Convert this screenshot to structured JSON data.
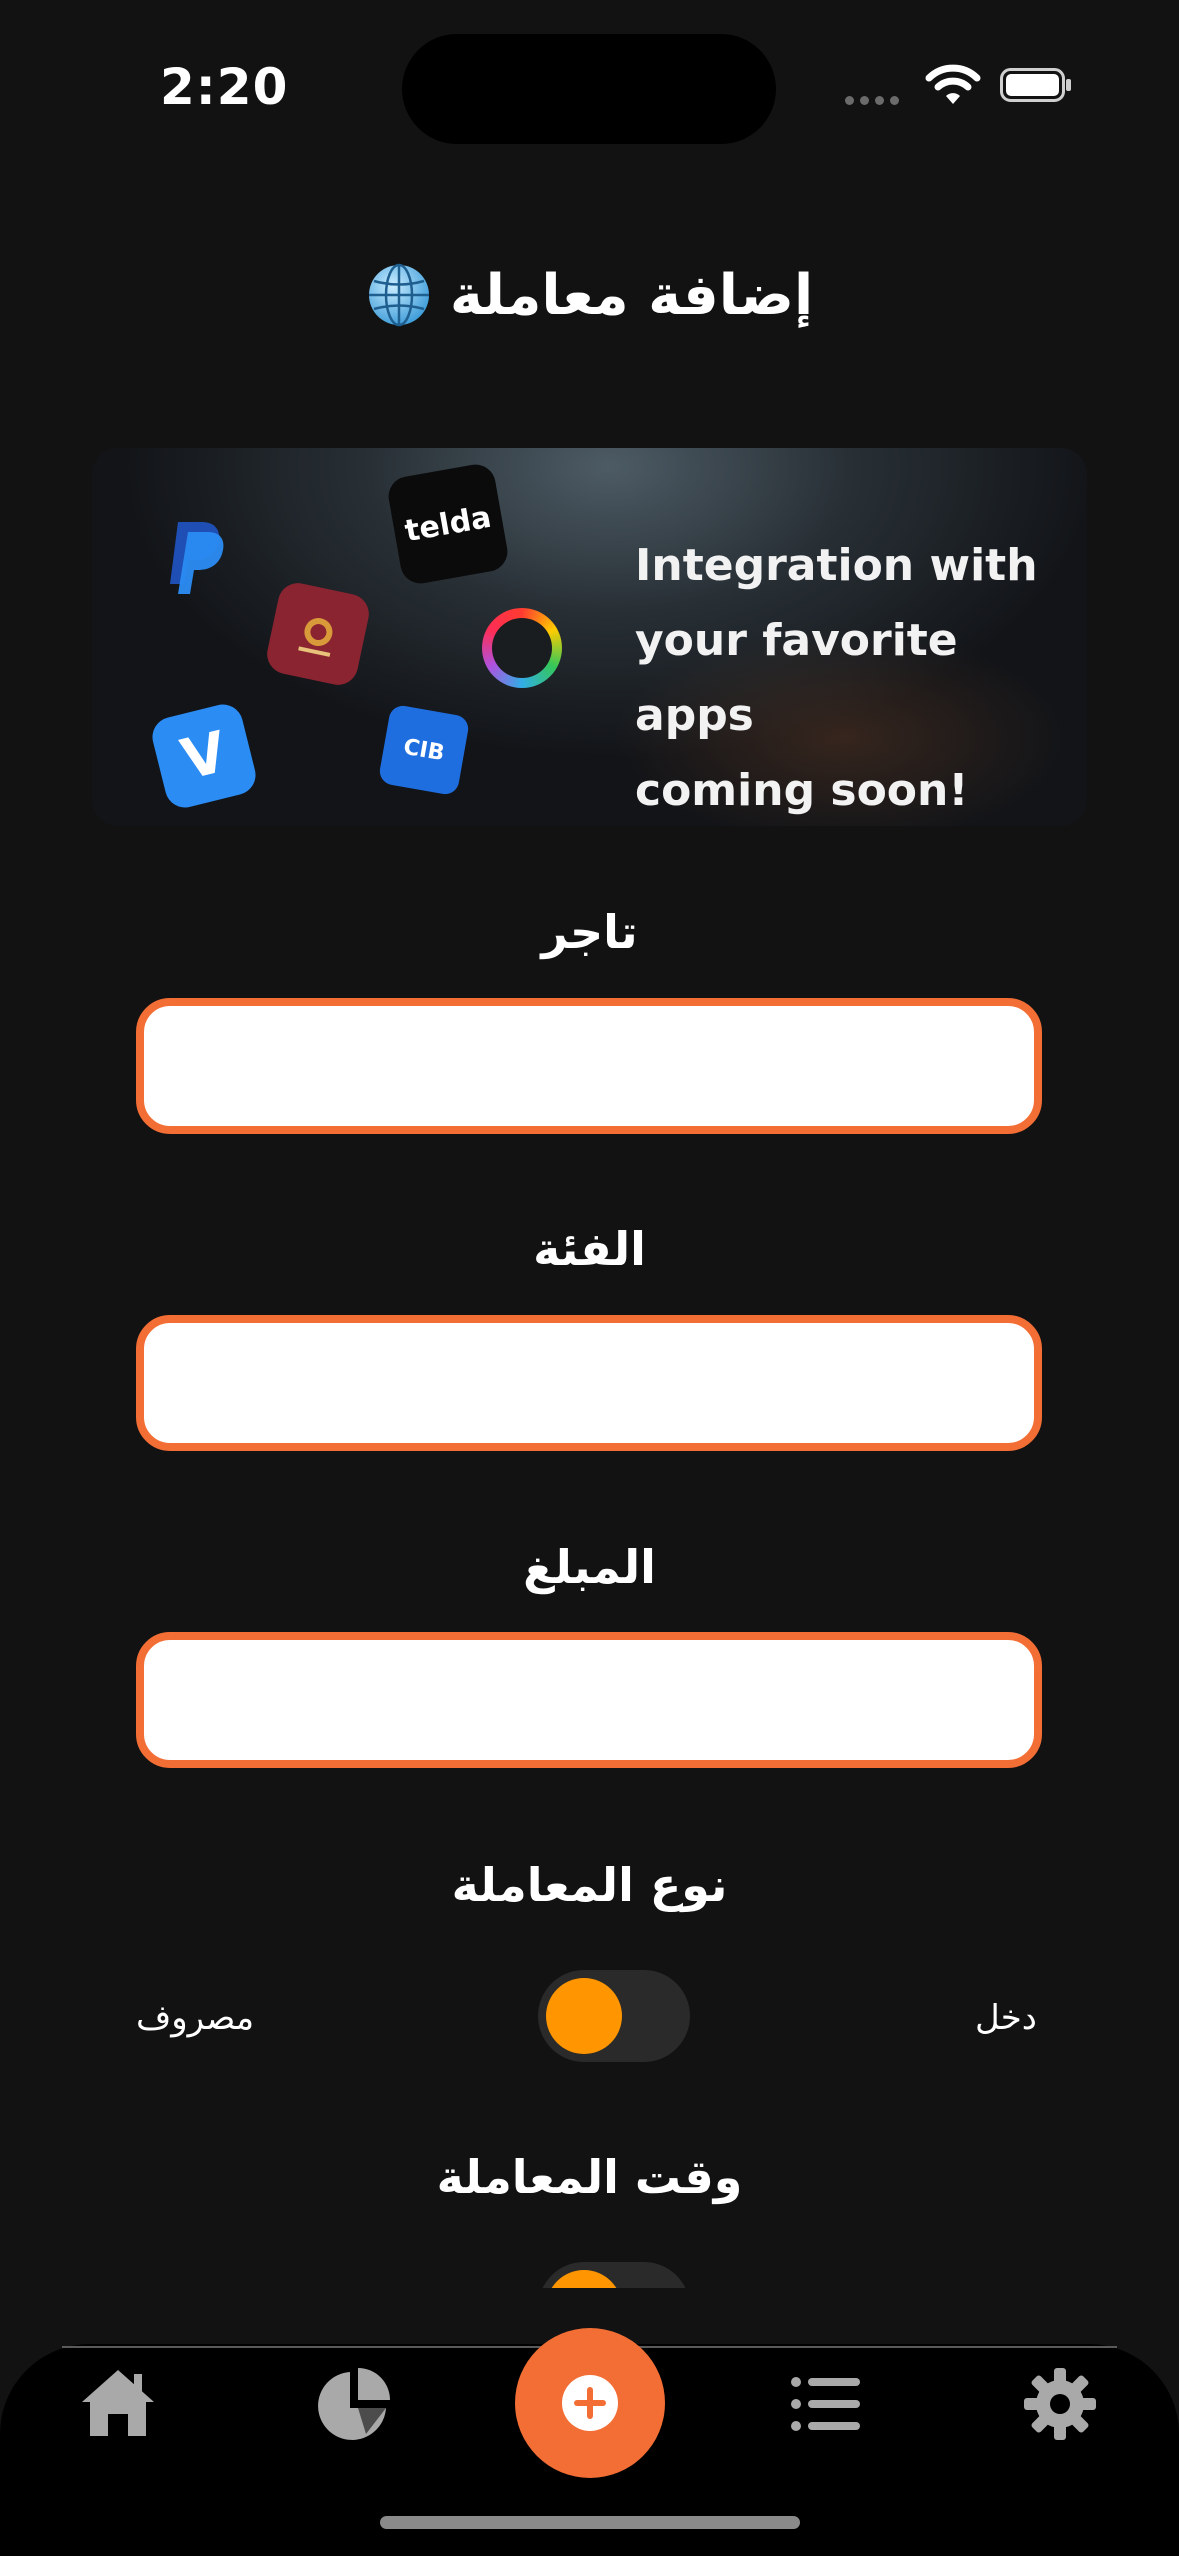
{
  "status_bar": {
    "time": "2:20",
    "icons": [
      "signal-dots-icon",
      "wifi-icon",
      "battery-icon"
    ]
  },
  "header": {
    "title": "إضافة معاملة",
    "icon": "globe-icon"
  },
  "banner": {
    "text_line1": "Integration with",
    "text_line2": "your favorite apps",
    "text_line3": "coming soon!",
    "logo_telda": "telda",
    "logo_cib": "CIB",
    "logo_venmo": "V",
    "logos": [
      "paypal-logo",
      "telda-logo",
      "banque-misr-logo",
      "color-ring-logo",
      "venmo-logo",
      "cib-logo"
    ]
  },
  "form": {
    "merchant": {
      "label": "تاجر",
      "value": ""
    },
    "category": {
      "label": "الفئة",
      "value": ""
    },
    "amount": {
      "label": "المبلغ",
      "value": ""
    },
    "transaction_type": {
      "label": "نوع المعاملة",
      "option_left": "مصروف",
      "option_right": "دخل"
    },
    "transaction_time": {
      "label": "وقت المعاملة"
    }
  },
  "tab_bar": {
    "items": [
      "home-icon",
      "pie-chart-icon",
      "add-icon",
      "list-icon",
      "gear-icon"
    ]
  },
  "colors": {
    "accent": "#f36e35",
    "toggle_knob": "#ff9500",
    "background": "#121212"
  }
}
